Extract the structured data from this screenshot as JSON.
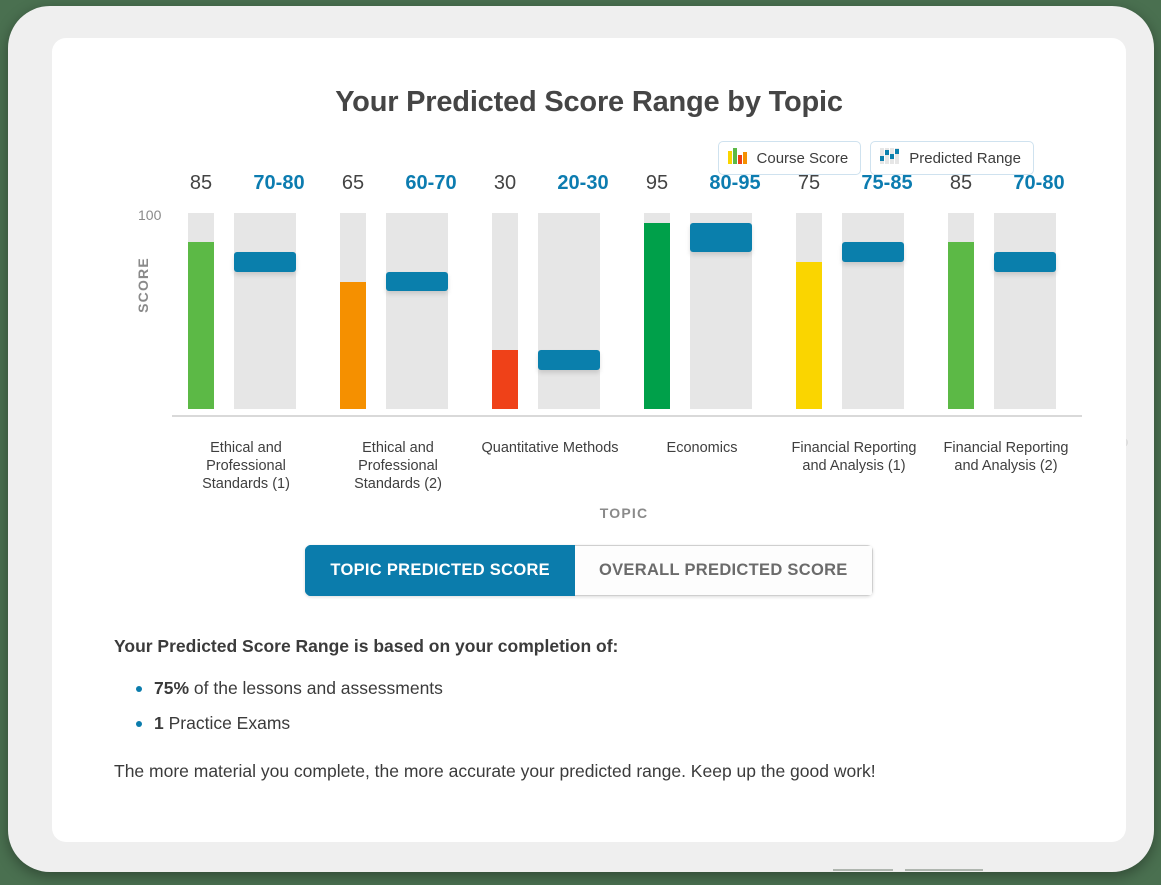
{
  "chart": {
    "title": "Your Predicted Score Range by Topic",
    "y_axis_title": "SCORE",
    "y_max_label": "100",
    "x_axis_title": "TOPIC"
  },
  "legend": [
    {
      "label": "Course Score",
      "icon": "bar-chart-color-icon"
    },
    {
      "label": "Predicted Range",
      "icon": "range-block-icon"
    }
  ],
  "toggle": {
    "active_label": "TOPIC PREDICTED SCORE",
    "inactive_label": "OVERALL PREDICTED SCORE"
  },
  "footer": {
    "heading": "Your Predicted Score Range is based on your completion of:",
    "bullets": [
      {
        "strong": "75%",
        "rest": " of the lessons and assessments"
      },
      {
        "strong": "1",
        "rest": " Practice Exams"
      }
    ],
    "note": "The more material you complete, the more accurate your predicted range. Keep up the good work!"
  },
  "colors": {
    "predicted_blue": "#0a7fac",
    "track_gray": "#e6e6e6",
    "accent_blue": "#0b7cac",
    "label_gray": "#8a8a8a"
  },
  "chart_data": {
    "type": "bar",
    "title": "Your Predicted Score Range by Topic",
    "xlabel": "TOPIC",
    "ylabel": "SCORE",
    "ylim": [
      0,
      100
    ],
    "grid": false,
    "legend_position": "top-right",
    "categories": [
      "Ethical and Professional Standards (1)",
      "Ethical and Professional Standards (2)",
      "Quantitative Methods",
      "Economics",
      "Financial Reporting and Analysis (1)",
      "Financial Reporting and Analysis (2)"
    ],
    "series": [
      {
        "name": "Course Score",
        "values": [
          85,
          65,
          30,
          95,
          75,
          85
        ],
        "labels": [
          "85",
          "65",
          "30",
          "95",
          "75",
          "85"
        ],
        "colors": [
          "#5cb946",
          "#f59000",
          "#ef4118",
          "#00a04a",
          "#fad500",
          "#5cb946"
        ]
      },
      {
        "name": "Predicted Range",
        "ranges": [
          [
            70,
            80
          ],
          [
            60,
            70
          ],
          [
            20,
            30
          ],
          [
            80,
            95
          ],
          [
            75,
            85
          ],
          [
            70,
            80
          ]
        ],
        "labels": [
          "70-80",
          "60-70",
          "20-30",
          "80-95",
          "75-85",
          "70-80"
        ],
        "color": "#0a7fac"
      }
    ]
  }
}
